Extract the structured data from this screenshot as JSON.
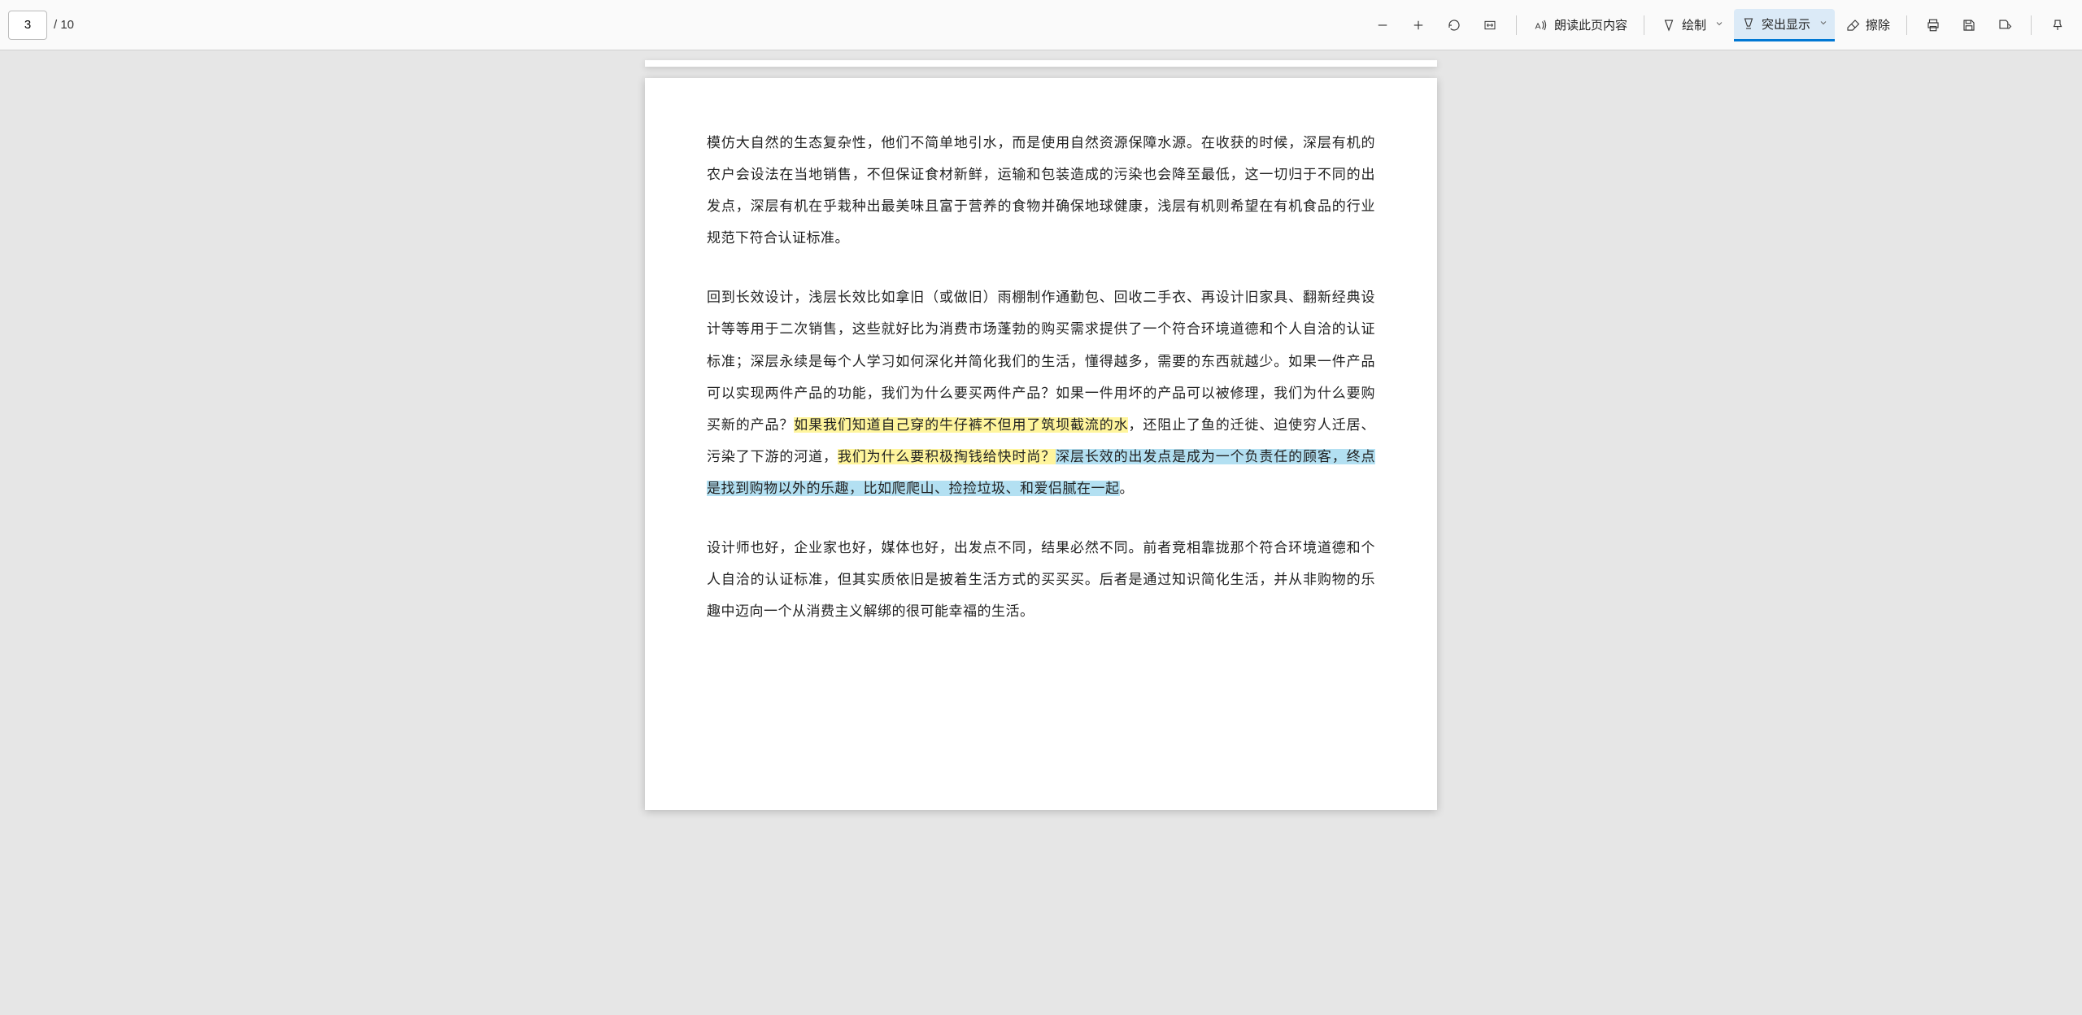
{
  "toolbar": {
    "page_current": "3",
    "page_total": "/ 10",
    "read_aloud_label": "朗读此页内容",
    "draw_label": "绘制",
    "highlight_label": "突出显示",
    "erase_label": "擦除"
  },
  "document": {
    "para1": "模仿大自然的生态复杂性，他们不简单地引水，而是使用自然资源保障水源。在收获的时候，深层有机的农户会设法在当地销售，不但保证食材新鲜，运输和包装造成的污染也会降至最低，这一切归于不同的出发点，深层有机在乎栽种出最美味且富于营养的食物并确保地球健康，浅层有机则希望在有机食品的行业规范下符合认证标准。",
    "para2_plain1": "回到长效设计，浅层长效比如拿旧（或做旧）雨棚制作通勤包、回收二手衣、再设计旧家具、翻新经典设计等等用于二次销售，这些就好比为消费市场蓬勃的购买需求提供了一个符合环境道德和个人自洽的认证标准；深层永续是每个人学习如何深化并简化我们的生活，懂得越多，需要的东西就越少。如果一件产品可以实现两件产品的功能，我们为什么要买两件产品？如果一件用坏的产品可以被修理，我们为什么要购买新的产品？",
    "para2_hl_yellow1": "如果我们知道自己穿的牛仔裤不但用了筑坝截流的水",
    "para2_plain2": "，还阻止了鱼的迁徙、迫使穷人迁居、污染了下游的河道，",
    "para2_hl_yellow2": "我们为什么要积极掏钱给快时尚？",
    "para2_hl_blue": "深层长效的出发点是成为一个负责任的顾客，终点是找到购物以外的乐趣，比如爬爬山、捡捡垃圾、和爱侣腻在一起",
    "para2_plain3": "。",
    "para3": "设计师也好，企业家也好，媒体也好，出发点不同，结果必然不同。前者竞相靠拢那个符合环境道德和个人自洽的认证标准，但其实质依旧是披着生活方式的买买买。后者是通过知识简化生活，并从非购物的乐趣中迈向一个从消费主义解绑的很可能幸福的生活。"
  }
}
